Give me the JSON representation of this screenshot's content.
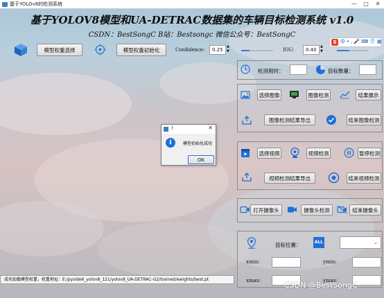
{
  "window": {
    "title": "基于YOLOv8的检测系统",
    "controls": [
      "—",
      "□",
      "✕"
    ]
  },
  "header": {
    "title": "基于YOLOV8模型和UA-DETRAC数据集的车辆目标检测系统 v1.0",
    "subtitle": "CSDN：BestSongC   B站：Bestsongc   微信公众号：BestSongC"
  },
  "toolbar": {
    "select_weights": "模型权重选择",
    "init_weights": "模型权重初始化",
    "confidence_label": "Confidence:",
    "confidence_value": "0.25",
    "confidence_fraction": 0.25,
    "iou_label": "IOU:",
    "iou_value": "0.40",
    "iou_fraction": 0.4
  },
  "ime": {
    "items": [
      "中",
      "•,",
      "🎤",
      "⌨",
      "👕",
      "▦"
    ]
  },
  "stats": {
    "time_label": "检测用时：",
    "time_value": "",
    "count_label": "目标数量：",
    "count_value": ""
  },
  "image": {
    "select": "选择图像",
    "detect": "图像检测",
    "show": "结果展示",
    "export": "图像检测结果导出",
    "end": "结束图像检测"
  },
  "video": {
    "select": "选择视频",
    "detect": "视频检测",
    "pause": "暂停检测",
    "export": "视频检测结果导出",
    "end": "结束视频检测"
  },
  "camera": {
    "open": "打开摄像头",
    "detect": "摄像头检测",
    "end": "结束摄像头"
  },
  "target": {
    "position_label": "目标位置：",
    "all_icon_text": "ALL",
    "xmin_label": "xmin:",
    "ymin_label": "ymin:",
    "xmax_label": "xmax:",
    "ymax_label": "ymax:",
    "xmin": "",
    "ymin": "",
    "xmax": "",
    "ymax": ""
  },
  "dialog": {
    "title": "!",
    "message": "模型初始化成功",
    "ok": "OK"
  },
  "status": {
    "text": "成功加载模型权重，权重地址：E:/pyside6_yolov8_121/yolov8_UA-DETRAC-G2/trained/weights/best.pt"
  },
  "watermark": "CSDN @BestSongC",
  "colors": {
    "accent": "#1f6fd6",
    "button_bg": "#e9e9e9"
  }
}
